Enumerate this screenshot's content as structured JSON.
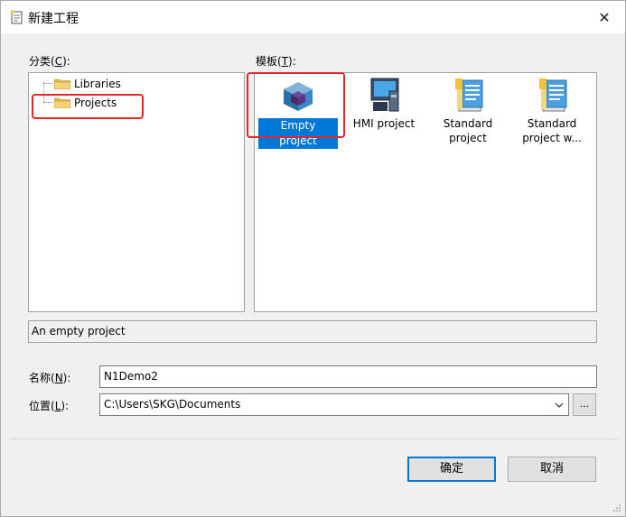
{
  "window": {
    "title": "新建工程",
    "close_glyph": "✕"
  },
  "categories": {
    "label_prefix": "分类(",
    "label_key": "C",
    "label_suffix": "):",
    "items": [
      {
        "label": "Libraries",
        "icon": "folder-icon",
        "selected": false
      },
      {
        "label": "Projects",
        "icon": "folder-icon",
        "selected": true
      }
    ]
  },
  "templates": {
    "label_prefix": "模板(",
    "label_key": "T",
    "label_suffix": "):",
    "items": [
      {
        "label": "Empty project",
        "icon": "cube-icon",
        "selected": true
      },
      {
        "label": "HMI project",
        "icon": "hmi-panel-icon",
        "selected": false
      },
      {
        "label": "Standard project",
        "label_line1": "Standard",
        "label_line2": "project",
        "icon": "standard-project-icon",
        "selected": false
      },
      {
        "label": "Standard project w...",
        "label_line1": "Standard",
        "label_line2": "project w...",
        "icon": "standard-project-icon",
        "selected": false
      }
    ]
  },
  "description": "An empty project",
  "name_field": {
    "label_prefix": "名称(",
    "label_key": "N",
    "label_suffix": "):",
    "value": "N1Demo2"
  },
  "location_field": {
    "label_prefix": "位置(",
    "label_key": "L",
    "label_suffix": "):",
    "value": "C:\\Users\\SKG\\Documents",
    "browse_label": "..."
  },
  "buttons": {
    "ok": "确定",
    "cancel": "取消"
  },
  "colors": {
    "accent": "#0078d7",
    "highlight_box": "#e8262a",
    "dialog_bg": "#f0f0f0"
  }
}
